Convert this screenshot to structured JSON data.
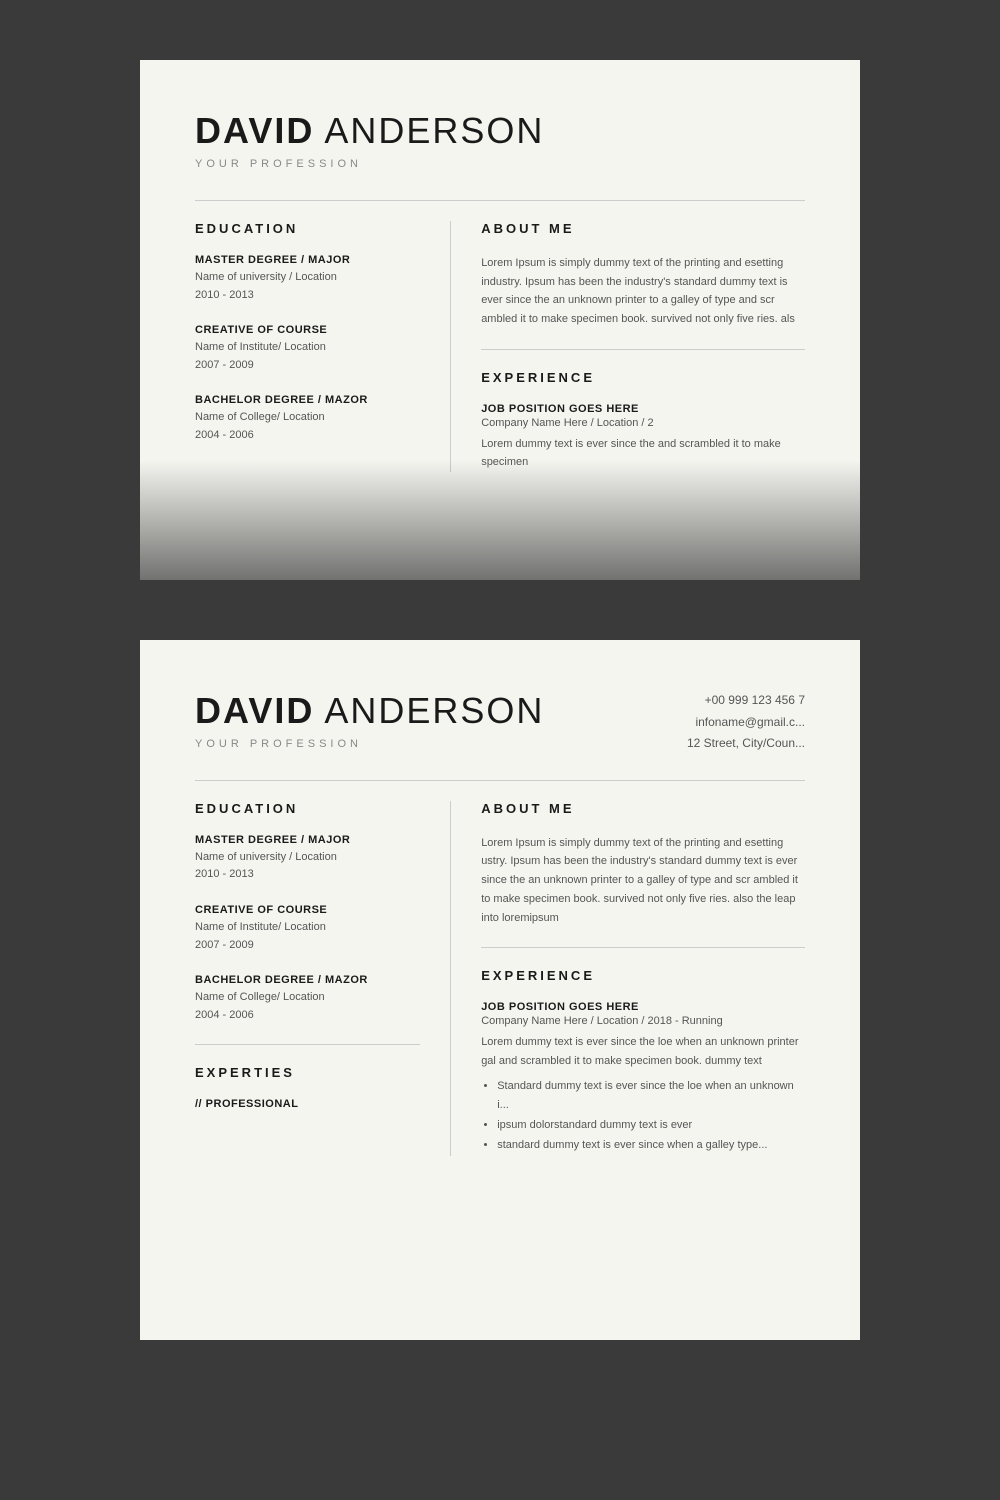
{
  "card1": {
    "firstName": "DAVID",
    "lastName": " ANDERSON",
    "profession": "YOUR PROFESSION",
    "sections": {
      "education": {
        "title": "EDUCATION",
        "items": [
          {
            "degree": "MASTER DEGREE / MAJOR",
            "institution": "Name of university / Location",
            "years": "2010 - 2013"
          },
          {
            "degree": "CREATIVE OF COURSE",
            "institution": "Name of Institute/ Location",
            "years": "2007 - 2009"
          },
          {
            "degree": "BACHELOR DEGREE / MAZOR",
            "institution": "Name of College/ Location",
            "years": "2004 - 2006"
          }
        ]
      },
      "aboutMe": {
        "title": "ABOUT ME",
        "text": "Lorem Ipsum is simply dummy text of the printing and esetting industry. Ipsum has been the industry's standard dummy text is ever since the an unknown printer to a galley of type and scr ambled it to make specimen book. survived not only five ries. als"
      },
      "experience": {
        "title": "EXPERIENCE",
        "items": [
          {
            "position": "JOB POSITION GOES HERE",
            "company": "Company Name Here / Location /  2",
            "desc": "Lorem dummy text is ever since the and scrambled it to make specimen"
          }
        ]
      }
    }
  },
  "card2": {
    "firstName": "DAVID",
    "lastName": " ANDERSON",
    "profession": "YOUR PROFESSION",
    "contact": {
      "phone": "+00 999 123 456 7",
      "email": "infoname@gmail.c...",
      "address": "12 Street, City/Coun..."
    },
    "sections": {
      "education": {
        "title": "EDUCATION",
        "items": [
          {
            "degree": "MASTER DEGREE / MAJOR",
            "institution": "Name of university / Location",
            "years": "2010 - 2013"
          },
          {
            "degree": "CREATIVE OF COURSE",
            "institution": "Name of Institute/ Location",
            "years": "2007 - 2009"
          },
          {
            "degree": "BACHELOR DEGREE / MAZOR",
            "institution": "Name of College/ Location",
            "years": "2004 - 2006"
          }
        ]
      },
      "aboutMe": {
        "title": "ABOUT ME",
        "text": "Lorem Ipsum is simply dummy text of the printing and esetting ustry. Ipsum has been the industry's standard dummy text is ever since the an unknown printer to a galley of type and scr ambled it to make  specimen book. survived not only five  ries. also the leap into loremipsum"
      },
      "experience": {
        "title": "EXPERIENCE",
        "items": [
          {
            "position": "JOB POSITION GOES HERE",
            "company": "Company Name Here / Location /  2018 - Running",
            "desc": "Lorem dummy text is ever since the loe when an unknown printer gal and scrambled it to make  specimen book. dummy text",
            "bullets": [
              "Standard dummy text is ever since the loe when an unknown i...",
              "ipsum dolorstandard dummy text is ever",
              "standard dummy text is ever since when a galley type..."
            ]
          }
        ]
      },
      "experties": {
        "title": "EXPERTIES",
        "items": [
          {
            "label": "// PROFESSIONAL"
          }
        ]
      }
    }
  }
}
